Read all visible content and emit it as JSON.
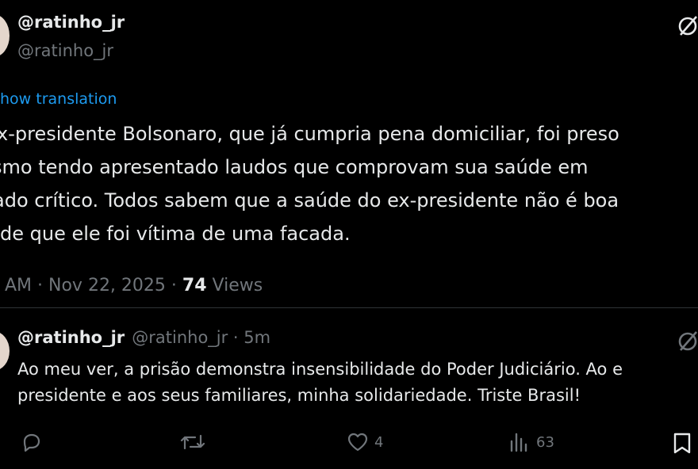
{
  "main_tweet": {
    "display_name": "@ratinho_jr",
    "handle": "@ratinho_jr",
    "translate_link": "how translation",
    "lines": [
      "x-presidente Bolsonaro, que já cumpria pena domiciliar, foi preso",
      "smo tendo apresentado laudos que comprovam sua saúde em",
      "ado crítico. Todos sabem que a saúde do ex-presidente não é boa",
      "de que ele foi vítima de uma facada."
    ],
    "time": "AM · Nov 22, 2025 · ",
    "views_count": "74",
    "views_label": " Views"
  },
  "reply": {
    "display_name": "@ratinho_jr",
    "handle_time": "@ratinho_jr · 5m",
    "lines": [
      "Ao meu ver, a prisão demonstra insensibilidade do Poder Judiciário. Ao e",
      "presidente e aos seus familiares,  minha solidariedade. Triste Brasil!"
    ],
    "likes": "4",
    "views": "63"
  },
  "icons": {
    "grok": "grok-icon",
    "reply": "reply-icon",
    "retweet": "retweet-icon",
    "like": "heart-icon",
    "views": "views-icon",
    "bookmark": "bookmark-icon"
  },
  "colors": {
    "link": "#1d9bf0",
    "muted": "#71767b",
    "text": "#e7e9ea"
  }
}
